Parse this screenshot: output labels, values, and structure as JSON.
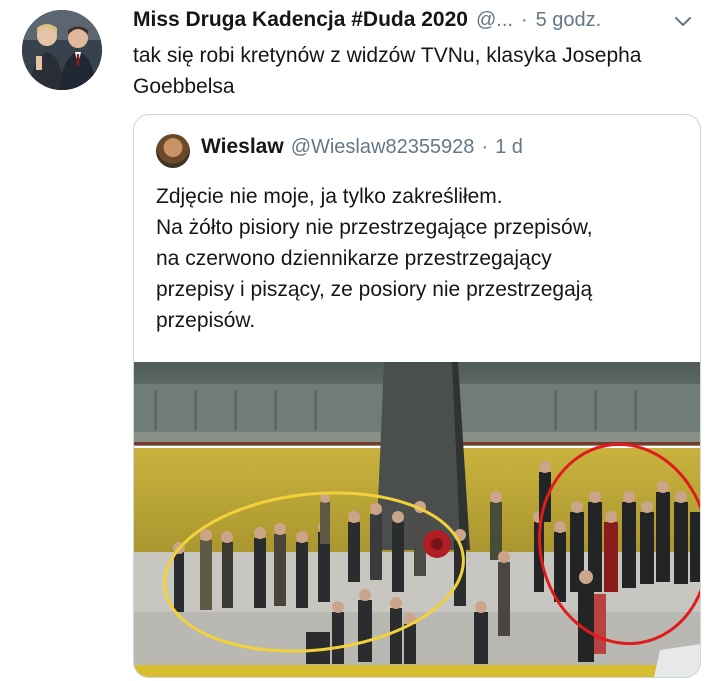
{
  "tweet": {
    "author_name": "Miss Druga Kadencja #Duda 2020",
    "author_handle": "@...",
    "separator": "·",
    "time": "5 godz.",
    "text": "tak się robi kretynów z widzów TVNu, klasyka Josepha Goebbelsa"
  },
  "quoted_tweet": {
    "author_name": "Wieslaw",
    "author_handle": "@Wieslaw82355928",
    "separator": "·",
    "time": "1 d",
    "text_lines": [
      "Zdjęcie nie moje, ja tylko zakreśliłem.",
      "Na żółto pisiory nie przestrzegające przepisów,",
      "na czerwono dziennikarze przestrzegający",
      "przepisy i piszący, ze posiory nie przestrzegają",
      "przepisów."
    ],
    "image": {
      "description": "Photo of a ceremony near a monument with yellow and red circled groups",
      "annotation_colors": {
        "yellow": "#f2d23a",
        "red": "#e01b1b"
      }
    }
  },
  "icons": {
    "chevron": "chevron-down-icon",
    "avatar": "avatar",
    "quoted_avatar": "avatar"
  }
}
